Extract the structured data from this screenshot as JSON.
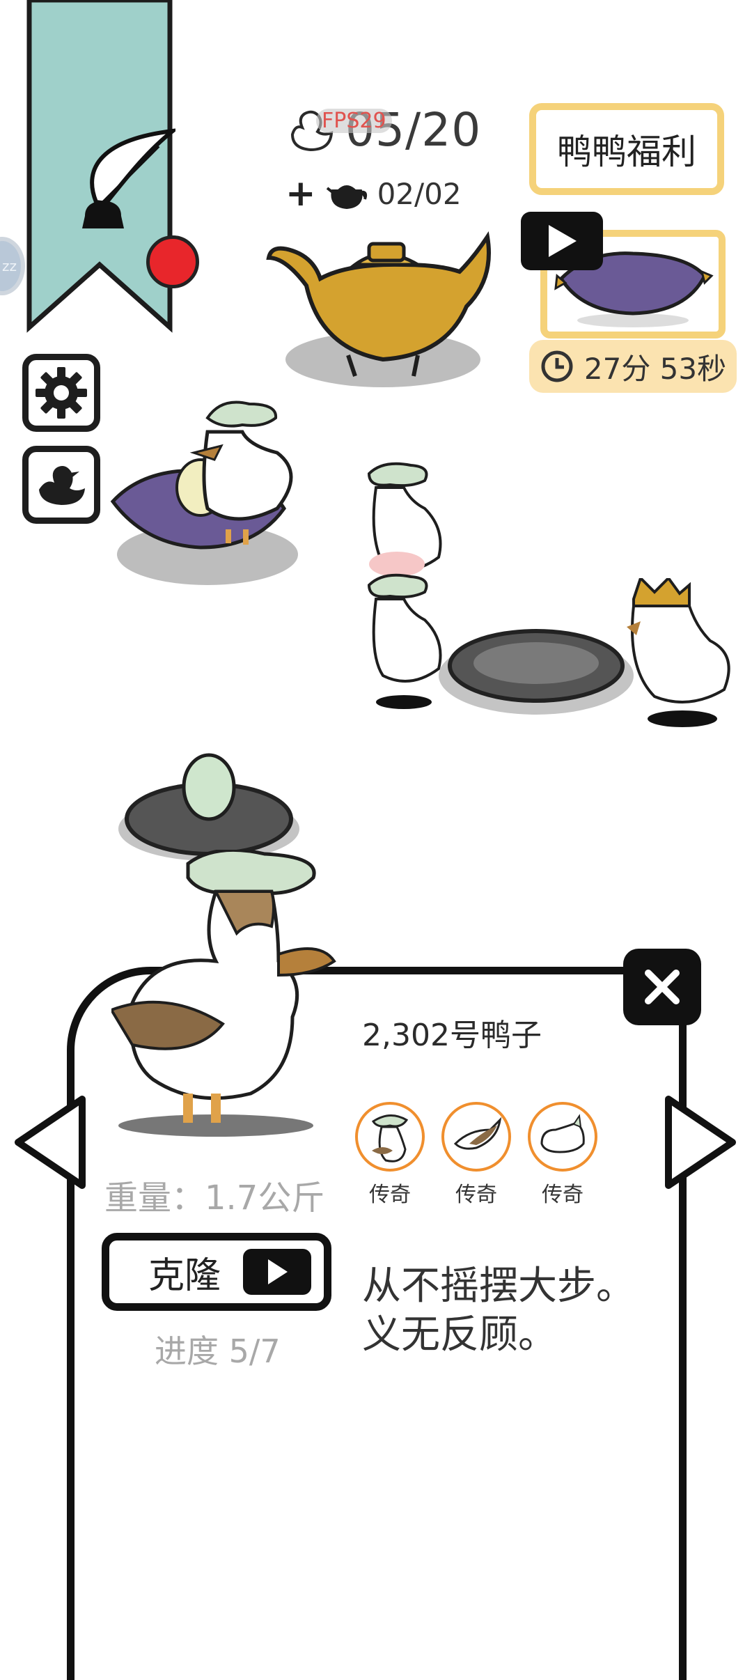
{
  "hud": {
    "fps_label": "FPS29",
    "duck_count": "05/20",
    "teapot_plus": "+",
    "teapot_count": "02/02",
    "welfare_button": "鸭鸭福利",
    "timer_text": "27分 53秒",
    "side_bubble": "zz"
  },
  "panel": {
    "duck_name": "2,302号鸭子",
    "traits": [
      {
        "label": "传奇",
        "icon": "mushroom-hat-duck-icon"
      },
      {
        "label": "传奇",
        "icon": "brown-wing-icon"
      },
      {
        "label": "传奇",
        "icon": "white-duck-body-icon"
      }
    ],
    "weight_text": "重量：1.7公斤",
    "clone_label": "克隆",
    "progress_text": "进度 5/7",
    "description_line1": "从不摇摆大步。",
    "description_line2": "义无反顾。"
  },
  "colors": {
    "banner": "#9fd0ca",
    "gold_border": "#f5d27a",
    "timer_bg": "#fbe3b0",
    "trait_ring": "#f08f2e",
    "red_dot": "#e8262b",
    "pillow_purple": "#6a5a96",
    "teapot_gold": "#d4a22f"
  }
}
